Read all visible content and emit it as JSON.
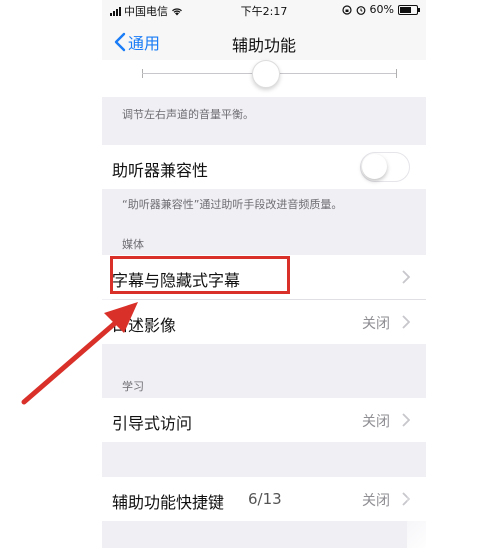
{
  "status_bar": {
    "carrier": "中国电信",
    "time": "下午2:17",
    "battery": "60%"
  },
  "nav": {
    "back_label": "通用",
    "title": "辅助功能"
  },
  "audio_balance": {
    "footnote": "调节左右声道的音量平衡。"
  },
  "hearing_aid": {
    "label": "助听器兼容性",
    "toggle_on": false,
    "footnote": "“助听器兼容性”通过助听手段改进音频质量。"
  },
  "media_section": {
    "header": "媒体",
    "items": [
      {
        "label": "字幕与隐藏式字幕",
        "value": ""
      },
      {
        "label": "口述影像",
        "value": "关闭"
      }
    ]
  },
  "learning_section": {
    "header": "学习",
    "items": [
      {
        "label": "引导式访问",
        "value": "关闭"
      }
    ]
  },
  "shortcut": {
    "label": "辅助功能快捷键",
    "count": "6/13",
    "value": "关闭"
  },
  "colors": {
    "accent": "#1a7cf6",
    "annotation": "#d9312a",
    "background": "#efeff4"
  }
}
